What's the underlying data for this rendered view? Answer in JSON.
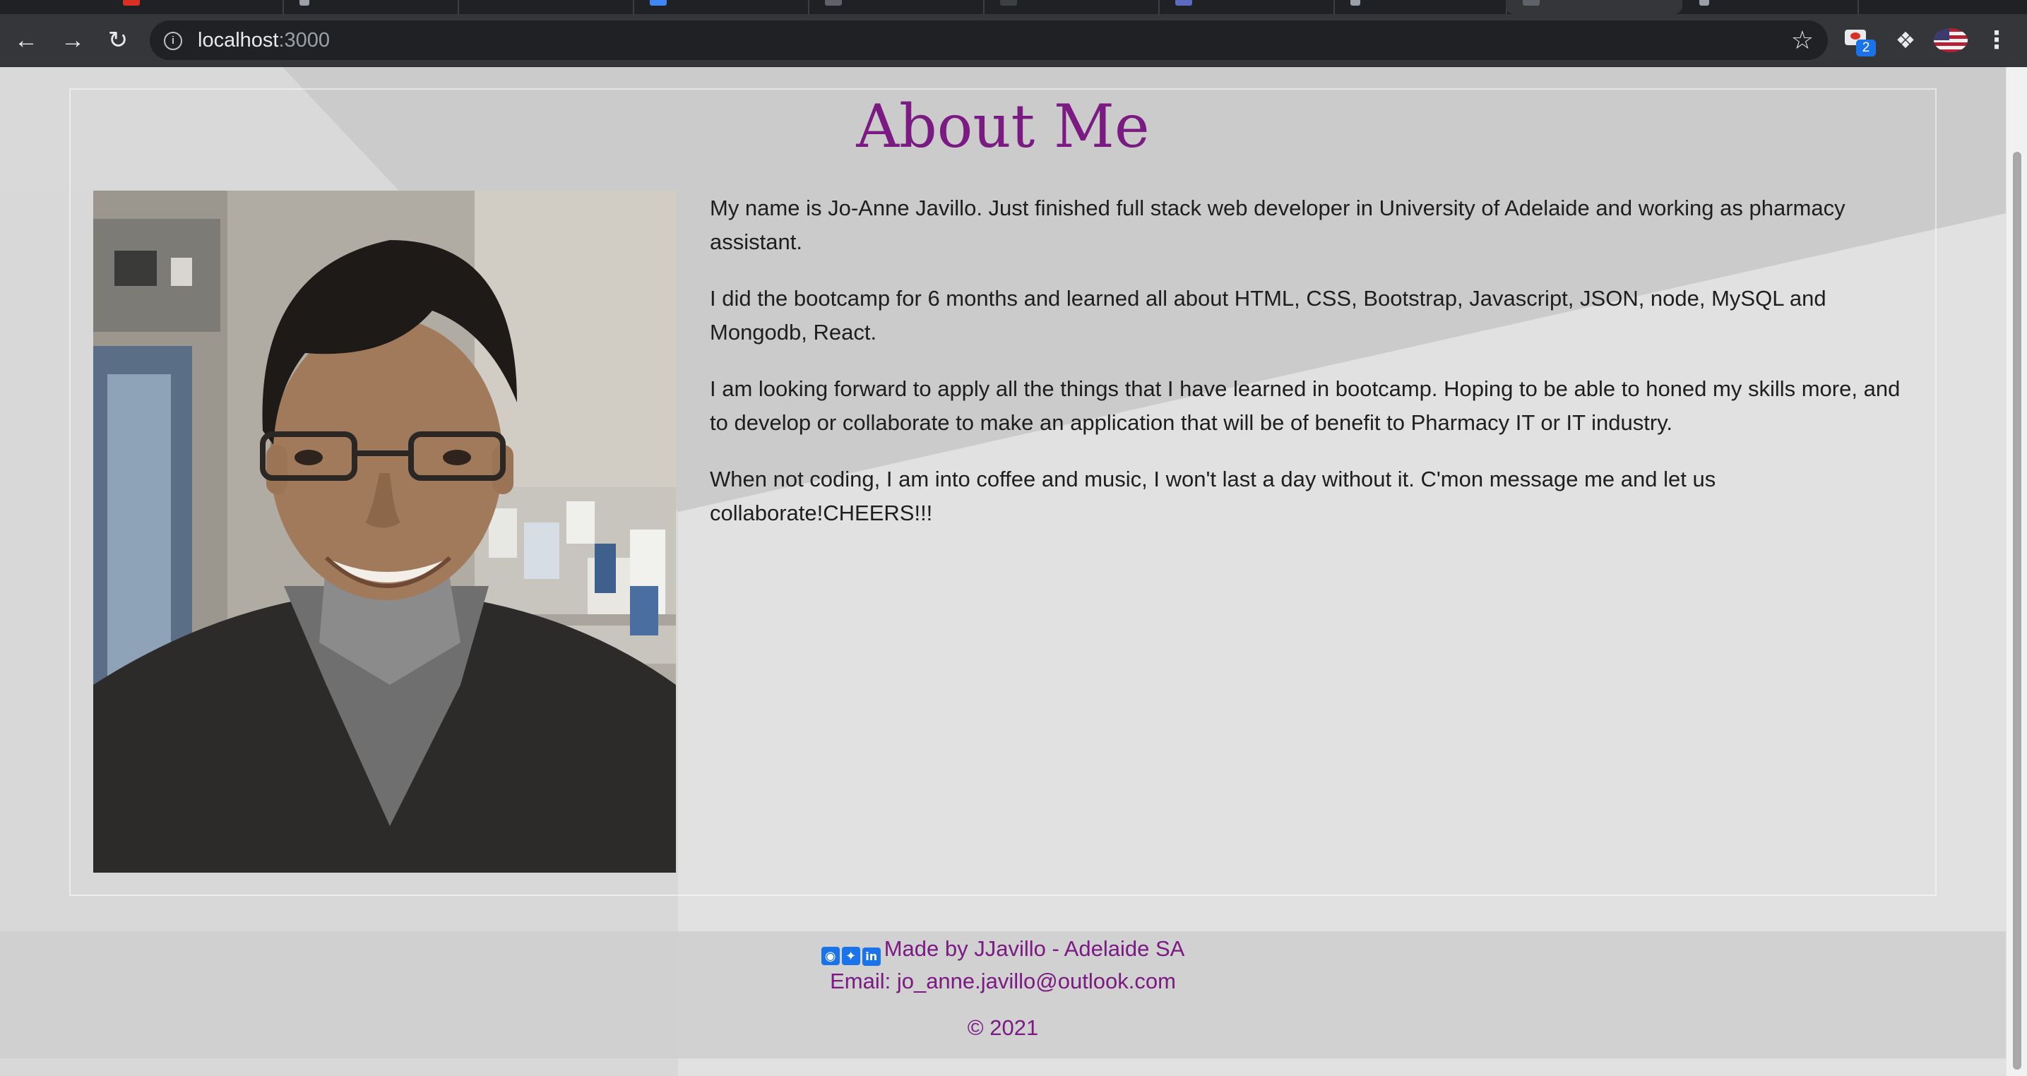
{
  "browser": {
    "url_host": "localhost",
    "url_port": ":3000",
    "extension_badge_count": "2"
  },
  "page": {
    "title": "About Me",
    "photo_alt": "Portrait of Jo-Anne Javillo",
    "bio": [
      "My name is Jo-Anne Javillo. Just finished full stack web developer in University of Adelaide and working as pharmacy assistant.",
      "I did the bootcamp for 6 months and learned all about HTML, CSS, Bootstrap, Javascript, JSON, node, MySQL and Mongodb, React.",
      "I am looking forward to apply all the things that I have learned in bootcamp. Hoping to be able to honed my skills more, and to develop or collaborate to make an application that will be of benefit to Pharmacy IT or IT industry.",
      "When not coding, I am into coffee and music, I won't last a day without it. C'mon message me and let us collaborate!CHEERS!!!"
    ]
  },
  "footer": {
    "social_icons": [
      "github-icon",
      "twitter-icon",
      "linkedin-icon"
    ],
    "made_by": "Made by JJavillo - Adelaide SA",
    "email": "Email: jo_anne.javillo@outlook.com",
    "copyright": "© 2021"
  },
  "colors": {
    "accent": "#7a1a82",
    "background": "#e0e0e0",
    "footer_bg": "#d0d0d0"
  }
}
